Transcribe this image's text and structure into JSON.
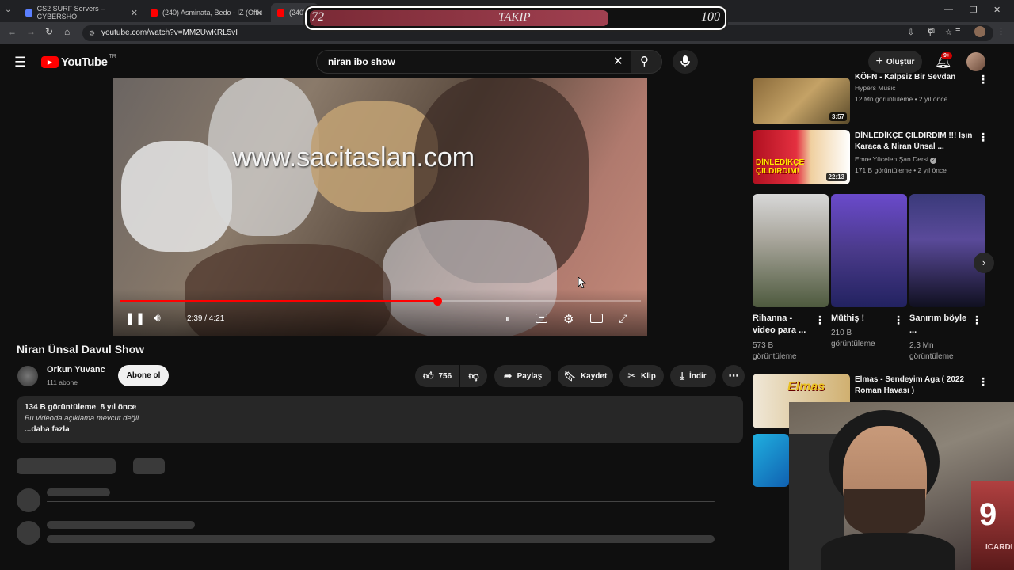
{
  "browser": {
    "tabs": [
      {
        "label": "CS2 SURF Servers – CYBERSHO",
        "color": "#5b7fff"
      },
      {
        "label": "(240) Asminata, Bedo - İZ (Offic",
        "color": "#ff0000"
      },
      {
        "label": "(240)",
        "color": "#ff0000"
      }
    ],
    "url": "youtube.com/watch?v=MM2UwKRL5vI"
  },
  "header": {
    "logo": "YouTube",
    "region": "TR",
    "search_value": "niran ibo show",
    "create_label": "Oluştur",
    "notif_badge": "9+"
  },
  "player": {
    "watermark": "www.sacitaslan.com",
    "time": "2:39 / 4:21",
    "progress": 0.609
  },
  "video": {
    "title": "Niran Ünsal Davul Show",
    "channel": "Orkun Yuvanc",
    "subs": "111 abone",
    "subscribe_label": "Abone ol",
    "likes": "756",
    "share_label": "Paylaş",
    "save_label": "Kaydet",
    "clip_label": "Klip",
    "download_label": "İndir",
    "views_line": "134 B görüntüleme  8 yıl önce",
    "desc": "Bu videoda açıklama mevcut değil.",
    "more": "...daha fazla"
  },
  "sidebar": {
    "items": [
      {
        "title": "KÖFN - Kalpsiz Bir Sevdan (2019)",
        "channel": "Hypers Music",
        "meta": "12 Mn görüntüleme • 2 yıl önce",
        "dur": "3:57"
      },
      {
        "title": "DİNLEDİKÇE ÇILDIRDIM !!! Işın Karaca & Niran Ünsal ...",
        "channel": "Emre Yücelen Şan Dersi",
        "meta": "171 B görüntüleme • 2 yıl önce",
        "dur": "22:13"
      },
      {
        "title": "Elmas - Sendeyim Aga ( 2022 Roman Havası )",
        "channel": "",
        "meta": "",
        "dur": ""
      }
    ],
    "shorts": [
      {
        "title": "Rihanna - video para ...",
        "views": "573 B görüntüleme"
      },
      {
        "title": "Müthiş !",
        "views": "210 B görüntüleme"
      },
      {
        "title": "Sanırım böyle ...",
        "views": "2,3 Mn görüntüleme"
      }
    ],
    "thumb2_text": "DİNLEDİKÇE ÇILDIRDIM!",
    "thumb3_text": "Elmas"
  },
  "overlay": {
    "left": "72",
    "label": "TAKIP",
    "right": "100",
    "fill": 0.72
  },
  "webcam": {
    "jersey": "9",
    "jersey_text": "ICARDI"
  },
  "colors": {
    "accent": "#ff0000",
    "bg": "#0f0f0f",
    "chip": "#272727"
  }
}
